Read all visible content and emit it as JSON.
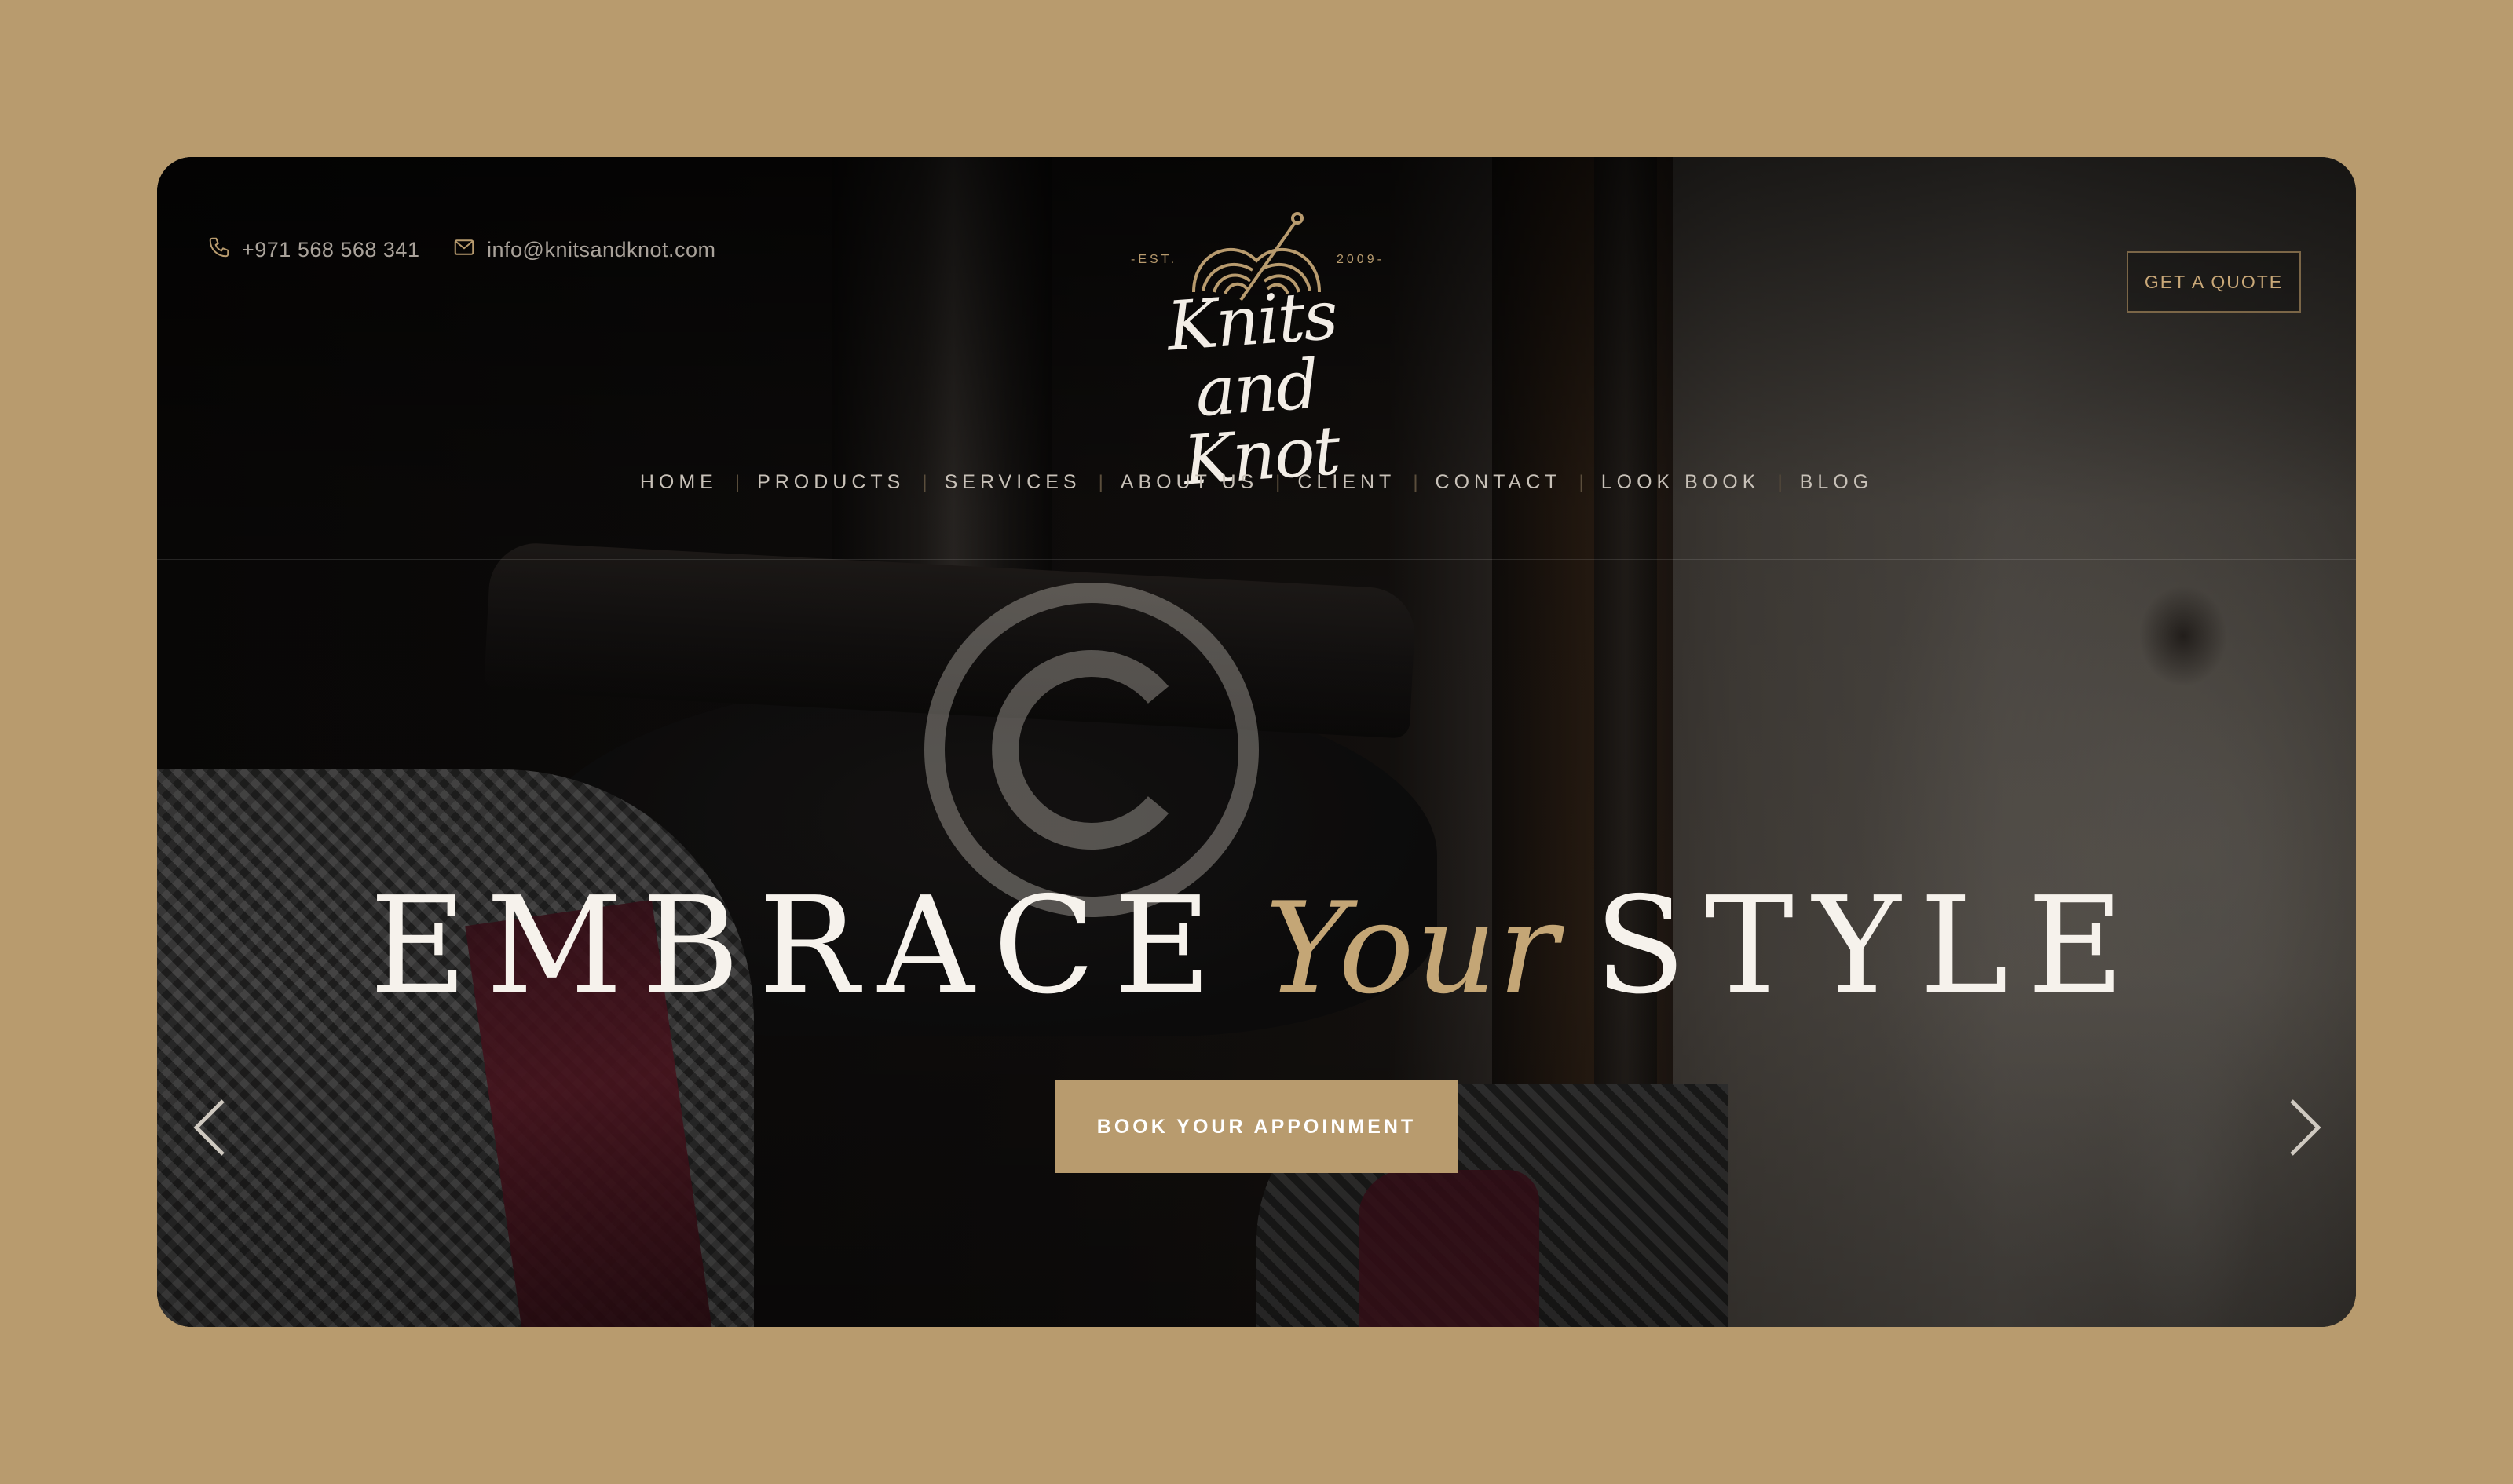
{
  "header": {
    "phone": "+971 568 568 341",
    "email": "info@knitsandknot.com",
    "logo": {
      "est_left": "-EST.",
      "est_right": "2009-",
      "name": "Knits and Knot"
    },
    "quote_button": "GET A QUOTE"
  },
  "nav": {
    "items": [
      {
        "label": "HOME"
      },
      {
        "label": "PRODUCTS"
      },
      {
        "label": "SERVICES"
      },
      {
        "label": "ABOUT US"
      },
      {
        "label": "CLIENT"
      },
      {
        "label": "CONTACT"
      },
      {
        "label": "LOOK BOOK"
      },
      {
        "label": "BLOG"
      }
    ],
    "separator": "|"
  },
  "hero": {
    "word1": "EMBRACE",
    "accent": "Your",
    "word2": "STYLE",
    "cta": "BOOK YOUR APPOINMENT"
  },
  "carousel": {
    "prev_icon": "chevron-left-icon",
    "next_icon": "chevron-right-icon"
  },
  "icons": {
    "phone": "phone-icon",
    "email": "mail-icon",
    "watermark": "copyright-icon"
  },
  "colors": {
    "page_background": "#b89b6e",
    "accent_gold": "#c4a676",
    "button_gold": "#b89b6e",
    "hero_text": "#f6f2ec"
  }
}
